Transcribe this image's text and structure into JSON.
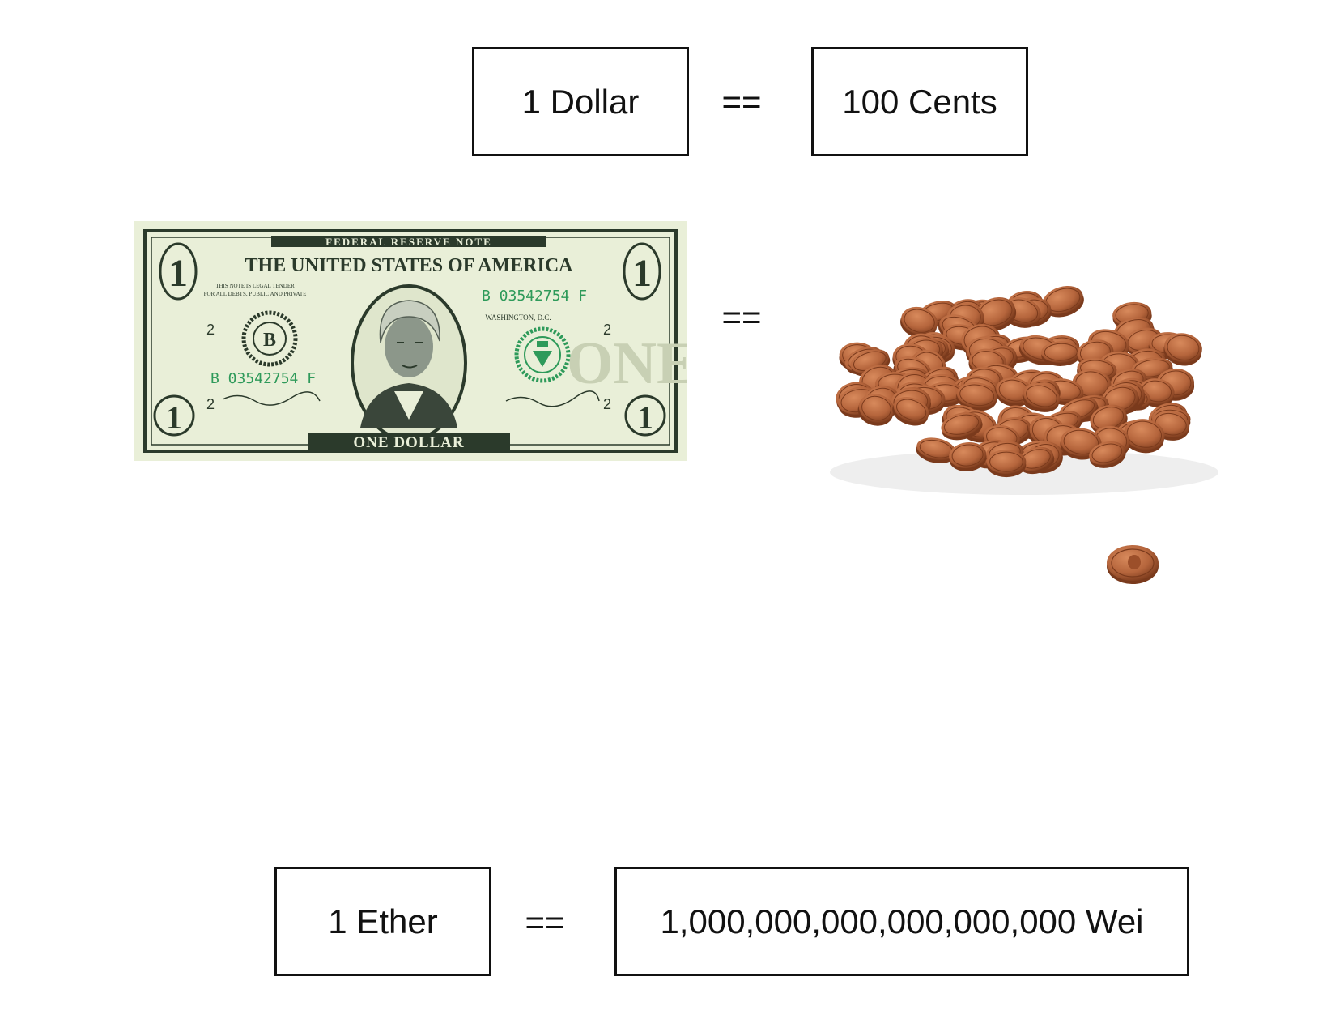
{
  "top": {
    "left_label": "1 Dollar",
    "equals": "==",
    "right_label": "100 Cents"
  },
  "middle": {
    "equals": "==",
    "bill": {
      "header": "FEDERAL RESERVE NOTE",
      "country": "THE UNITED STATES OF AMERICA",
      "tender_line1": "THIS NOTE IS LEGAL TENDER",
      "tender_line2": "FOR ALL DEBTS, PUBLIC AND PRIVATE",
      "serial": "B 03542754 F",
      "seal_letter": "B",
      "city": "WASHINGTON, D.C.",
      "corner_number": "1",
      "district_number": "2",
      "denomination": "ONE DOLLAR",
      "watermark": "ONE",
      "colors": {
        "paper": "#e9efd8",
        "ink": "#2b3a2b",
        "serial_green": "#2e9a5a"
      }
    },
    "coins": {
      "color": "#b5653c",
      "highlight": "#d88a5c",
      "shadow": "#7a3a1c"
    }
  },
  "bottom": {
    "left_label": "1 Ether",
    "equals": "==",
    "right_label": "1,000,000,000,000,000,000 Wei"
  }
}
